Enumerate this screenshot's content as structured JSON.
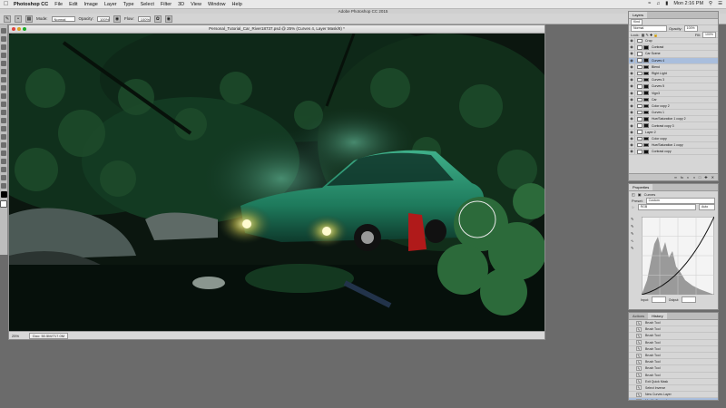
{
  "menubar": {
    "app_name": "Photoshop CC",
    "items": [
      "File",
      "Edit",
      "Image",
      "Layer",
      "Type",
      "Select",
      "Filter",
      "3D",
      "View",
      "Window",
      "Help"
    ],
    "clock": "Mon 2:16 PM"
  },
  "app_title": "Adobe Photoshop CC 2015",
  "options_bar": {
    "mode_label": "Mode:",
    "mode_value": "Normal",
    "opacity_label": "Opacity:",
    "opacity_value": "100%",
    "flow_label": "Flow:",
    "flow_value": "100%"
  },
  "document": {
    "title": "Personal_Tutorial_Car_River18737.psd @ 25% (Curves 4, Layer Mask/8) *",
    "zoom": "25%",
    "doc_info": "Doc: 50.5M/717.0M"
  },
  "layers_panel": {
    "tabs": [
      "Layers"
    ],
    "kind_label": "Kind",
    "blend_mode": "Normal",
    "opacity_label": "Opacity:",
    "opacity_value": "100%",
    "lock_label": "Lock:",
    "fill_label": "Fill:",
    "fill_value": "100%",
    "layers": [
      {
        "name": "Crop",
        "selected": false,
        "mask": false
      },
      {
        "name": "Contrast",
        "selected": false,
        "mask": true
      },
      {
        "name": "Car Scene",
        "selected": false,
        "mask": false
      },
      {
        "name": "Curves 4",
        "selected": true,
        "mask": true
      },
      {
        "name": "Blend",
        "selected": false,
        "mask": true
      },
      {
        "name": "Right Light",
        "selected": false,
        "mask": true
      },
      {
        "name": "Curves 3",
        "selected": false,
        "mask": true
      },
      {
        "name": "Curves 5",
        "selected": false,
        "mask": true
      },
      {
        "name": "Vign3",
        "selected": false,
        "mask": true
      },
      {
        "name": "Car",
        "selected": false,
        "mask": true
      },
      {
        "name": "Color copy 2",
        "selected": false,
        "mask": true
      },
      {
        "name": "Curves 1",
        "selected": false,
        "mask": true
      },
      {
        "name": "Hue/Saturation 1 copy 2",
        "selected": false,
        "mask": true
      },
      {
        "name": "Contrast copy 3",
        "selected": false,
        "mask": true
      },
      {
        "name": "Layer 2",
        "selected": false,
        "mask": false
      },
      {
        "name": "Color copy",
        "selected": false,
        "mask": true
      },
      {
        "name": "Hue/Saturation 1 copy",
        "selected": false,
        "mask": true
      },
      {
        "name": "Contrast copy",
        "selected": false,
        "mask": true
      }
    ]
  },
  "properties_panel": {
    "tab": "Properties",
    "title": "Curves",
    "preset_label": "Preset:",
    "preset_value": "Custom",
    "channel_value": "RGB",
    "auto_label": "Auto",
    "input_label": "Input:",
    "output_label": "Output:"
  },
  "history_panel": {
    "tabs": [
      "Actions",
      "History"
    ],
    "items": [
      {
        "name": "Brush Tool",
        "selected": false
      },
      {
        "name": "Brush Tool",
        "selected": false
      },
      {
        "name": "Brush Tool",
        "selected": false
      },
      {
        "name": "Brush Tool",
        "selected": false
      },
      {
        "name": "Brush Tool",
        "selected": false
      },
      {
        "name": "Brush Tool",
        "selected": false
      },
      {
        "name": "Brush Tool",
        "selected": false
      },
      {
        "name": "Brush Tool",
        "selected": false
      },
      {
        "name": "Brush Tool",
        "selected": false
      },
      {
        "name": "Exit Quick Mask",
        "selected": false
      },
      {
        "name": "Select Inverse",
        "selected": false
      },
      {
        "name": "New Curves Layer",
        "selected": false
      },
      {
        "name": "Modify Curves Layer",
        "selected": true
      }
    ]
  },
  "colors": {
    "selected_row": "#a9bedd",
    "canvas_bg": "#0b140e",
    "car_green": "#1e7a5c"
  }
}
